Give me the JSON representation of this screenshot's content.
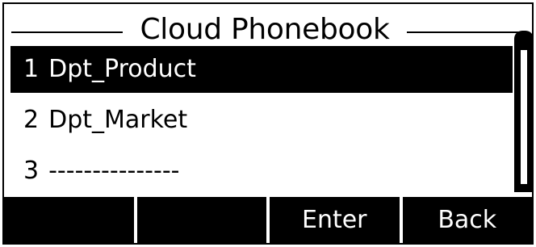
{
  "title": "Cloud Phonebook",
  "items": [
    {
      "number": "1",
      "label": "Dpt_Product",
      "selected": true
    },
    {
      "number": "2",
      "label": "Dpt_Market",
      "selected": false
    },
    {
      "number": "3",
      "label": "---------------",
      "selected": false
    }
  ],
  "softkeys": [
    "",
    "",
    "Enter",
    "Back"
  ]
}
